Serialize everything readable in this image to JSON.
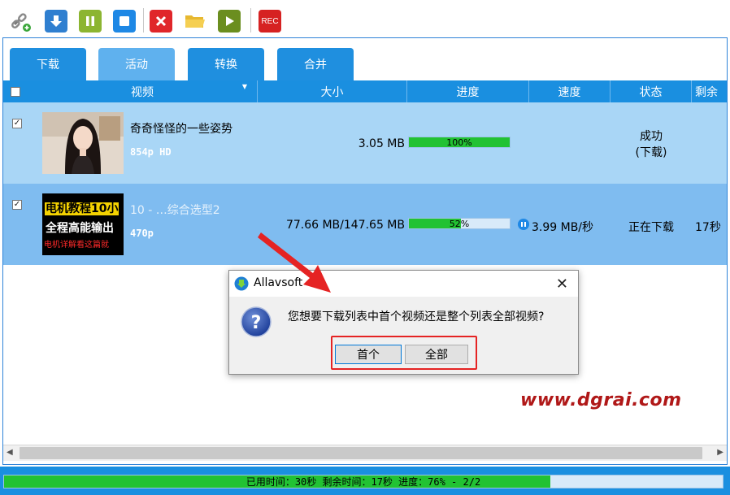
{
  "toolbar": {
    "buttons": [
      {
        "name": "add-link",
        "icon": "link-add-icon"
      },
      {
        "name": "download",
        "icon": "download-arrow-icon"
      },
      {
        "name": "pause",
        "icon": "pause-icon"
      },
      {
        "name": "stop",
        "icon": "stop-icon"
      },
      {
        "name": "delete",
        "icon": "close-x-icon"
      },
      {
        "name": "open-folder",
        "icon": "folder-icon"
      },
      {
        "name": "play",
        "icon": "play-icon"
      },
      {
        "name": "record",
        "icon": "rec-icon",
        "label": "REC"
      }
    ]
  },
  "tabs": [
    {
      "label": "下载"
    },
    {
      "label": "活动",
      "active": true
    },
    {
      "label": "转换"
    },
    {
      "label": "合并"
    }
  ],
  "table": {
    "columns": [
      "视频",
      "大小",
      "进度",
      "速度",
      "状态",
      "剩余"
    ],
    "rows": [
      {
        "checked": true,
        "title": "奇奇怪怪的一些姿势",
        "resolution": "854p HD",
        "size": "3.05 MB",
        "progress": 1.0,
        "progress_text": "100%",
        "speed": "",
        "status_line1": "成功",
        "status_line2": "(下载)",
        "remaining": ""
      },
      {
        "checked": true,
        "title": "10 - …综合选型2",
        "resolution": "470p",
        "size": "77.66 MB/147.65 MB",
        "progress": 0.52,
        "progress_text": "52%",
        "speed": "3.99 MB/秒",
        "status_line1": "正在下载",
        "status_line2": "",
        "remaining": "17秒",
        "thumb_text_1": "电机教程10小",
        "thumb_text_2": "全程高能输出",
        "thumb_text_3": "电机详解看这篇就"
      }
    ]
  },
  "status_bar": {
    "text": "已用时间：30秒 剩余时间：17秒 进度：76% - 2/2",
    "progress": 0.76
  },
  "dialog": {
    "title": "Allavsoft",
    "message": "您想要下载列表中首个视频还是整个列表全部视频?",
    "btn_first": "首个",
    "btn_all": "全部"
  },
  "watermark": "www.dgrai.com",
  "colors": {
    "accent": "#1a8fe0",
    "progress_green": "#22c233",
    "row_selected": "#7fbcf0",
    "row_normal": "#a9d6f6",
    "highlight_red": "#e52323"
  }
}
